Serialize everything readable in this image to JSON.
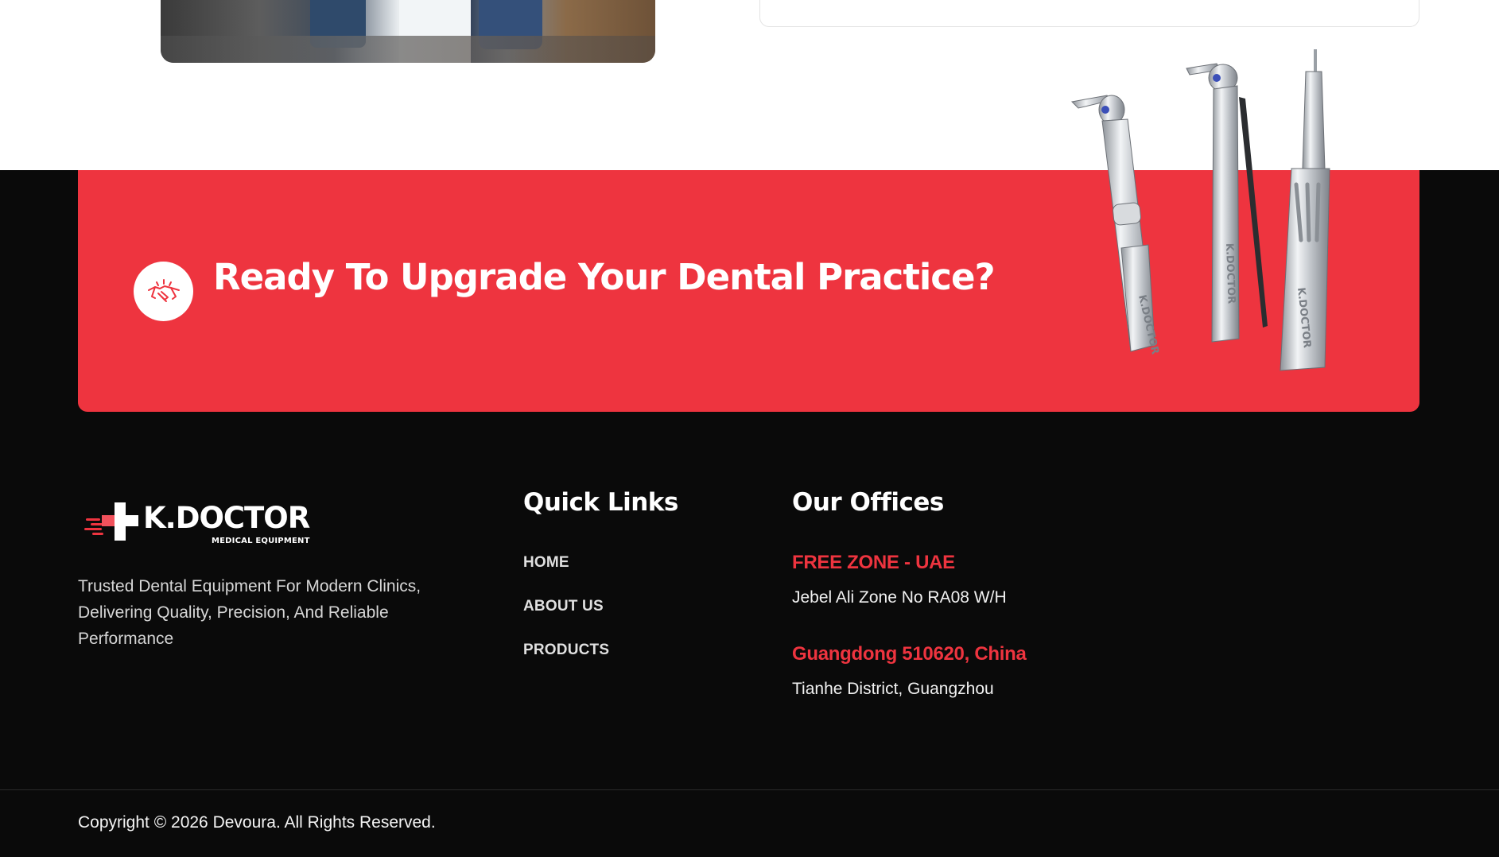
{
  "cta": {
    "title": "Ready To Upgrade Your Dental Practice?",
    "icon": "handshake-icon",
    "accent": "#ee343f"
  },
  "brand": {
    "name": "K.DOCTOR",
    "tagline": "MEDICAL EQUIPMENT",
    "description": "Trusted Dental Equipment For Modern Clinics, Delivering Quality, Precision, And Reliable Performance"
  },
  "product_labels": [
    "K.DOCTOR",
    "K.DOCTOR",
    "K.DOCTOR"
  ],
  "quick_links": {
    "title": "Quick Links",
    "items": [
      "HOME",
      "ABOUT US",
      "PRODUCTS"
    ]
  },
  "offices": {
    "title": "Our Offices",
    "items": [
      {
        "name": "FREE ZONE - UAE",
        "address": "Jebel Ali Zone No RA08 W/H"
      },
      {
        "name": "Guangdong 510620, China",
        "address": "Tianhe District, Guangzhou"
      }
    ]
  },
  "footer": {
    "copyright": "Copyright © 2026 Devoura. All Rights Reserved."
  },
  "colors": {
    "accent_red": "#ee343f",
    "footer_bg": "#0a0a0a"
  }
}
